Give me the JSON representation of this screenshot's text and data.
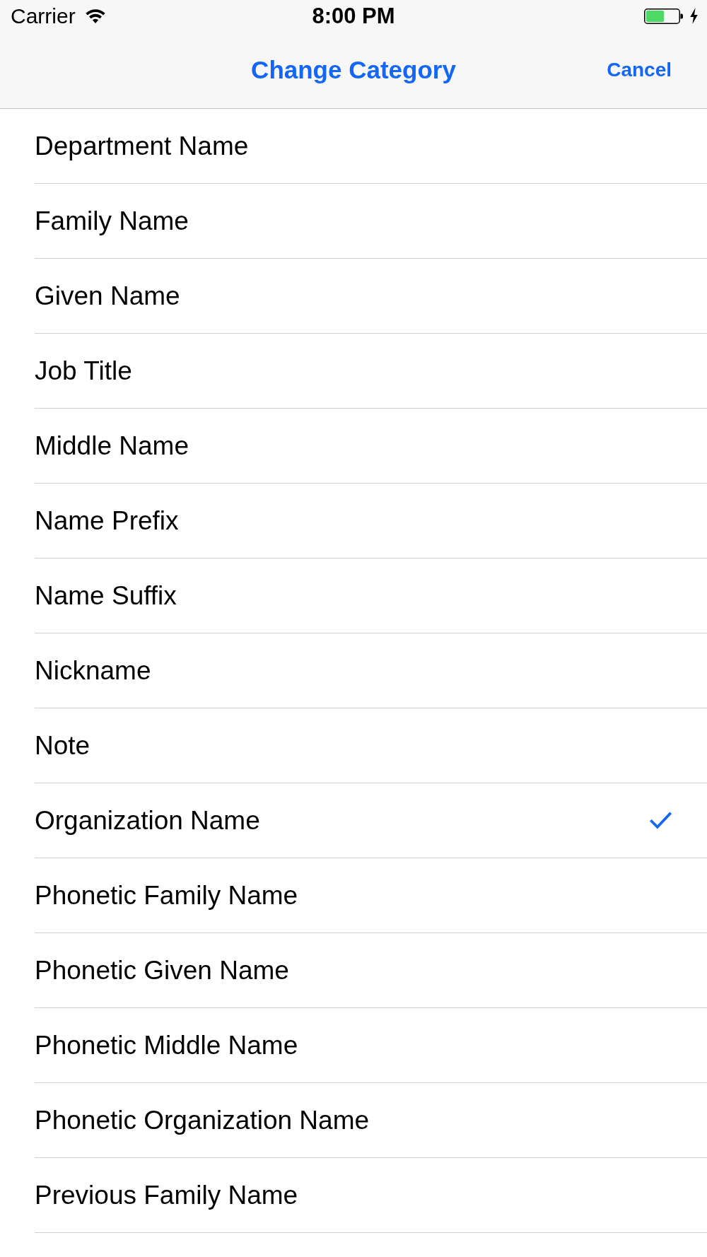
{
  "status_bar": {
    "carrier": "Carrier",
    "time": "8:00 PM"
  },
  "nav_bar": {
    "title": "Change Category",
    "cancel": "Cancel"
  },
  "items": [
    {
      "label": "Department Name",
      "selected": false
    },
    {
      "label": "Family Name",
      "selected": false
    },
    {
      "label": "Given Name",
      "selected": false
    },
    {
      "label": "Job Title",
      "selected": false
    },
    {
      "label": "Middle Name",
      "selected": false
    },
    {
      "label": "Name Prefix",
      "selected": false
    },
    {
      "label": "Name Suffix",
      "selected": false
    },
    {
      "label": "Nickname",
      "selected": false
    },
    {
      "label": "Note",
      "selected": false
    },
    {
      "label": "Organization Name",
      "selected": true
    },
    {
      "label": "Phonetic Family Name",
      "selected": false
    },
    {
      "label": "Phonetic Given Name",
      "selected": false
    },
    {
      "label": "Phonetic Middle Name",
      "selected": false
    },
    {
      "label": "Phonetic Organization Name",
      "selected": false
    },
    {
      "label": "Previous Family Name",
      "selected": false
    }
  ]
}
